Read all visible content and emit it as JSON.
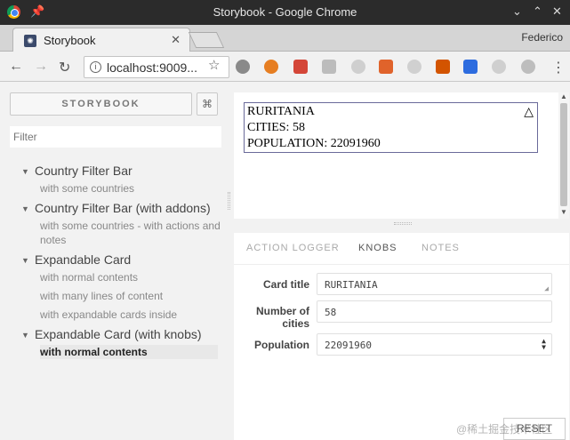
{
  "window": {
    "title": "Storybook - Google Chrome"
  },
  "browser": {
    "tab_label": "Storybook",
    "profile": "Federico",
    "url": "localhost:9009..."
  },
  "sidebar": {
    "brand": "STORYBOOK",
    "shortcut": "⌘",
    "filter_placeholder": "Filter",
    "kinds": [
      {
        "label": "Country Filter Bar",
        "stories": [
          "with some countries"
        ]
      },
      {
        "label": "Country Filter Bar (with addons)",
        "stories": [
          "with some countries - with actions and notes"
        ]
      },
      {
        "label": "Expandable Card",
        "stories": [
          "with normal contents",
          "with many lines of content",
          "with expandable cards inside"
        ]
      },
      {
        "label": "Expandable Card (with knobs)",
        "stories": [
          "with normal contents"
        ]
      }
    ],
    "selected_story": "with normal contents"
  },
  "preview": {
    "card_title": "RURITANIA",
    "cities_line": "CITIES: 58",
    "population_line": "POPULATION: 22091960",
    "expand_symbol": "△"
  },
  "addons": {
    "tabs": [
      "ACTION LOGGER",
      "KNOBS",
      "NOTES"
    ],
    "active_tab": "KNOBS",
    "knobs": [
      {
        "label": "Card title",
        "value": "RURITANIA"
      },
      {
        "label": "Number of cities",
        "value": "58"
      },
      {
        "label": "Population",
        "value": "22091960"
      }
    ],
    "reset_label": "RESET"
  },
  "watermark": "@稀土掘金技术社区"
}
